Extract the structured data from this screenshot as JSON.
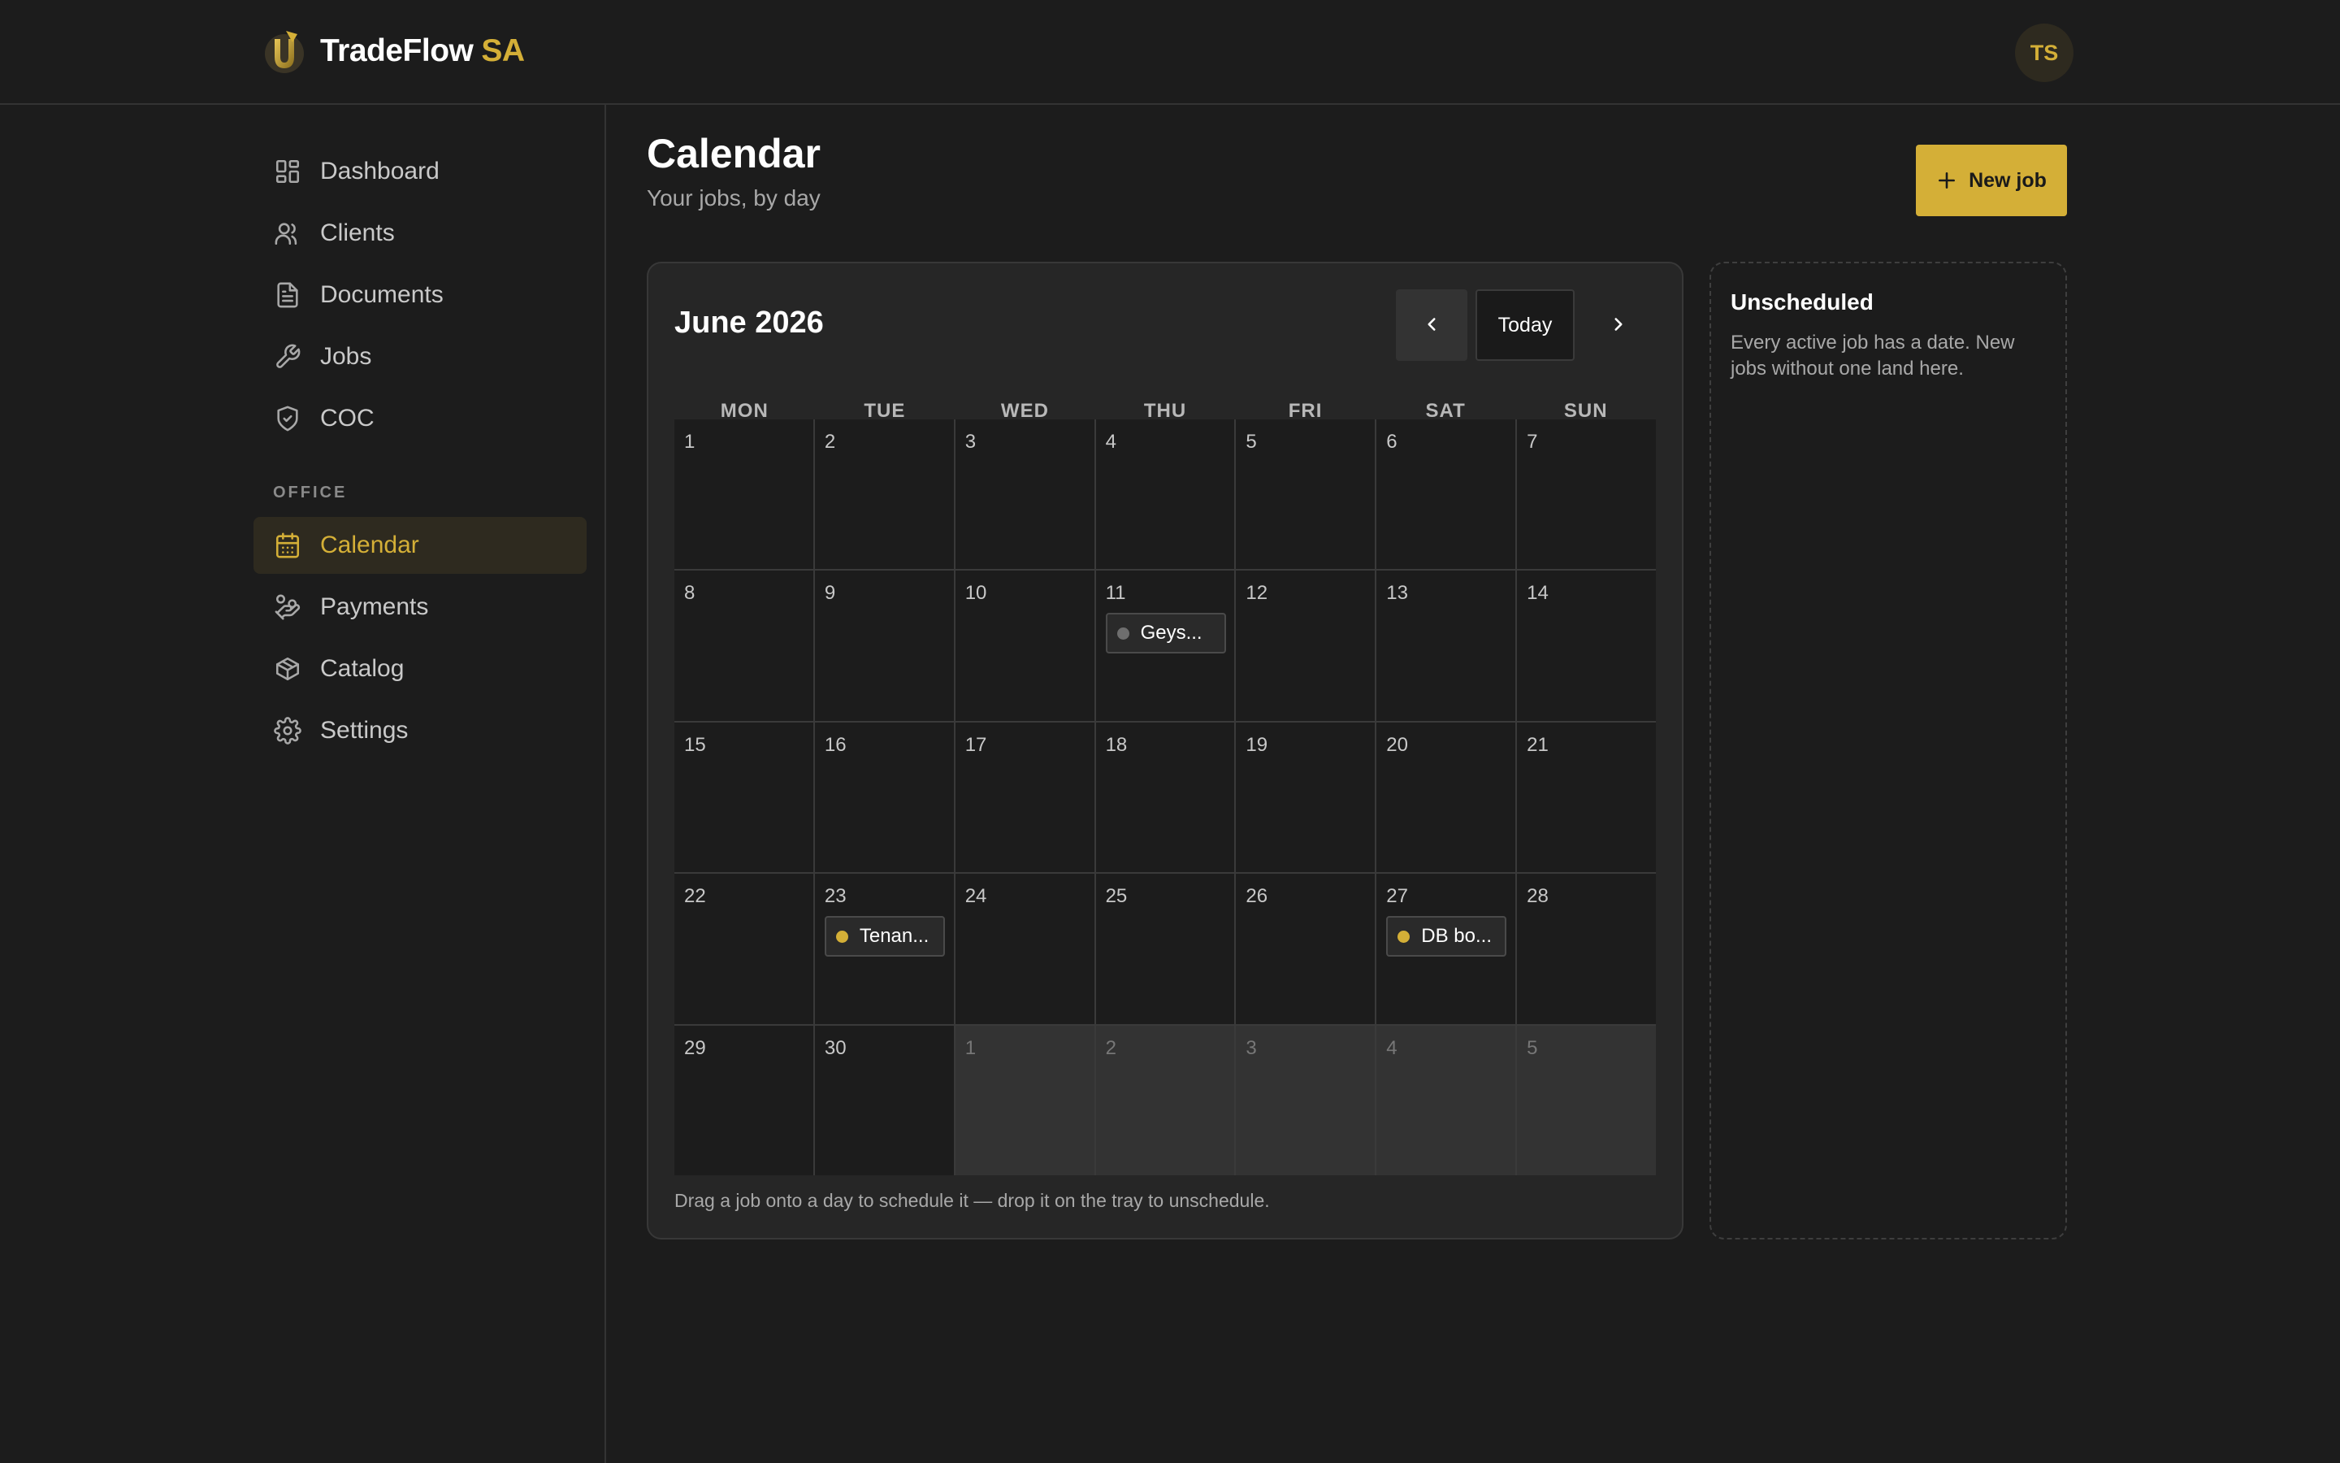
{
  "brand": {
    "name": "TradeFlow",
    "accent": "SA"
  },
  "user": {
    "initials": "TS"
  },
  "sidebar": {
    "items": [
      {
        "label": "Dashboard"
      },
      {
        "label": "Clients"
      },
      {
        "label": "Documents"
      },
      {
        "label": "Jobs"
      },
      {
        "label": "COC"
      }
    ],
    "section_label": "OFFICE",
    "office_items": [
      {
        "label": "Calendar",
        "active": true
      },
      {
        "label": "Payments"
      },
      {
        "label": "Catalog"
      },
      {
        "label": "Settings"
      }
    ]
  },
  "page": {
    "title": "Calendar",
    "subtitle": "Your jobs, by day",
    "new_job_label": "New job"
  },
  "calendar": {
    "month_label": "June 2026",
    "today_label": "Today",
    "weekdays": [
      "MON",
      "TUE",
      "WED",
      "THU",
      "FRI",
      "SAT",
      "SUN"
    ],
    "days": [
      {
        "n": "1"
      },
      {
        "n": "2"
      },
      {
        "n": "3"
      },
      {
        "n": "4"
      },
      {
        "n": "5"
      },
      {
        "n": "6"
      },
      {
        "n": "7"
      },
      {
        "n": "8"
      },
      {
        "n": "9"
      },
      {
        "n": "10"
      },
      {
        "n": "11",
        "job": {
          "label": "Geys...",
          "status_color": "#6e6e6e"
        }
      },
      {
        "n": "12"
      },
      {
        "n": "13"
      },
      {
        "n": "14"
      },
      {
        "n": "15"
      },
      {
        "n": "16"
      },
      {
        "n": "17"
      },
      {
        "n": "18"
      },
      {
        "n": "19"
      },
      {
        "n": "20"
      },
      {
        "n": "21"
      },
      {
        "n": "22"
      },
      {
        "n": "23",
        "job": {
          "label": "Tenan...",
          "status_color": "#d4af37"
        }
      },
      {
        "n": "24"
      },
      {
        "n": "25"
      },
      {
        "n": "26"
      },
      {
        "n": "27",
        "job": {
          "label": "DB bo...",
          "status_color": "#d4af37"
        }
      },
      {
        "n": "28"
      },
      {
        "n": "29"
      },
      {
        "n": "30"
      },
      {
        "n": "1",
        "outside": true
      },
      {
        "n": "2",
        "outside": true
      },
      {
        "n": "3",
        "outside": true
      },
      {
        "n": "4",
        "outside": true
      },
      {
        "n": "5",
        "outside": true
      }
    ],
    "hint": "Drag a job onto a day to schedule it — drop it on the tray to unschedule."
  },
  "tray": {
    "title": "Unscheduled",
    "description": "Every active job has a date. New jobs without one land here."
  },
  "colors": {
    "accent": "#d4af37",
    "background": "#1c1c1c",
    "card": "#262626"
  },
  "icons": {
    "nav": [
      "dashboard-icon",
      "clients-icon",
      "document-icon",
      "wrench-icon",
      "shield-check-icon"
    ],
    "office": [
      "calendar-icon",
      "payments-icon",
      "catalog-box-icon",
      "gear-icon"
    ]
  }
}
